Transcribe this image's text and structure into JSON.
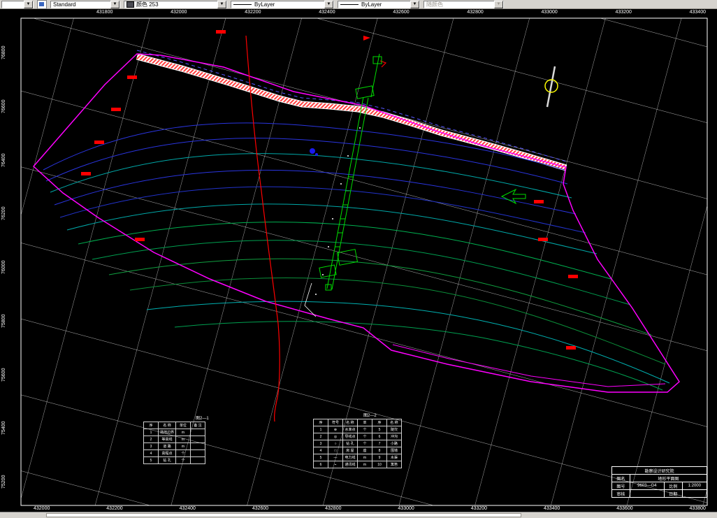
{
  "toolbar": {
    "style_value": "Standard",
    "color_value": "颜色 253",
    "linetype_value": "ByLayer",
    "lineweight_value": "ByLayer",
    "plotstyle_value": "随颜色"
  },
  "map": {
    "top_labels": [
      "431800",
      "432000",
      "432200",
      "432400",
      "432600",
      "432800",
      "433000",
      "433200",
      "433400"
    ],
    "bottom_labels": [
      "432000",
      "432200",
      "432400",
      "432600",
      "432800",
      "433000",
      "433200",
      "433400",
      "433600",
      "433800"
    ],
    "left_labels": [
      "76800",
      "76600",
      "76400",
      "76200",
      "76000",
      "75800",
      "75600",
      "75400",
      "75200"
    ],
    "table1": {
      "title": "图2—1",
      "rows": [
        [
          "序",
          "名  称",
          "单位",
          "备  注"
        ],
        [
          "1",
          "场地边界",
          "m",
          ""
        ],
        [
          "2",
          "等高线",
          "m",
          ""
        ],
        [
          "3",
          "道  路",
          "m",
          ""
        ],
        [
          "4",
          "高程点",
          "个",
          ""
        ],
        [
          "5",
          "钻  孔",
          "个",
          ""
        ]
      ]
    },
    "table2": {
      "title": "图2—2",
      "rows": [
        [
          "序",
          "符号",
          "名  称",
          "单",
          "序",
          "名 称"
        ],
        [
          "1",
          "⊕",
          "水准点",
          "个",
          "5",
          "陡坎"
        ],
        [
          "2",
          "◎",
          "导线点",
          "个",
          "6",
          "冲沟"
        ],
        [
          "3",
          "○",
          "钻  孔",
          "个",
          "7",
          "小路"
        ],
        [
          "4",
          "□",
          "房  屋",
          "座",
          "8",
          "围墙"
        ],
        [
          "5",
          "—",
          "电力线",
          "m",
          "9",
          "水渠"
        ],
        [
          "6",
          "⌁",
          "通讯线",
          "m",
          "10",
          "篱笆"
        ]
      ]
    },
    "titleblock": {
      "org": "勘察设计研究院",
      "name_label": "图名",
      "name_value": "地形平面图",
      "no_label": "图号",
      "no_value": "9603—G4",
      "scale_label": "比例",
      "scale_value": "1:2000",
      "check_label": "审核",
      "date_label": "日期"
    }
  },
  "colors": {
    "boundary": "#ff00ff",
    "contour_blue": "#2a35e0",
    "contour_cyan": "#00a8a8",
    "contour_green": "#00a050",
    "road_hatch": "#ff4040",
    "grid": "#ffffff",
    "highlight": "#ff0000",
    "structures": "#00dd00",
    "north_ring": "#ffff00"
  }
}
